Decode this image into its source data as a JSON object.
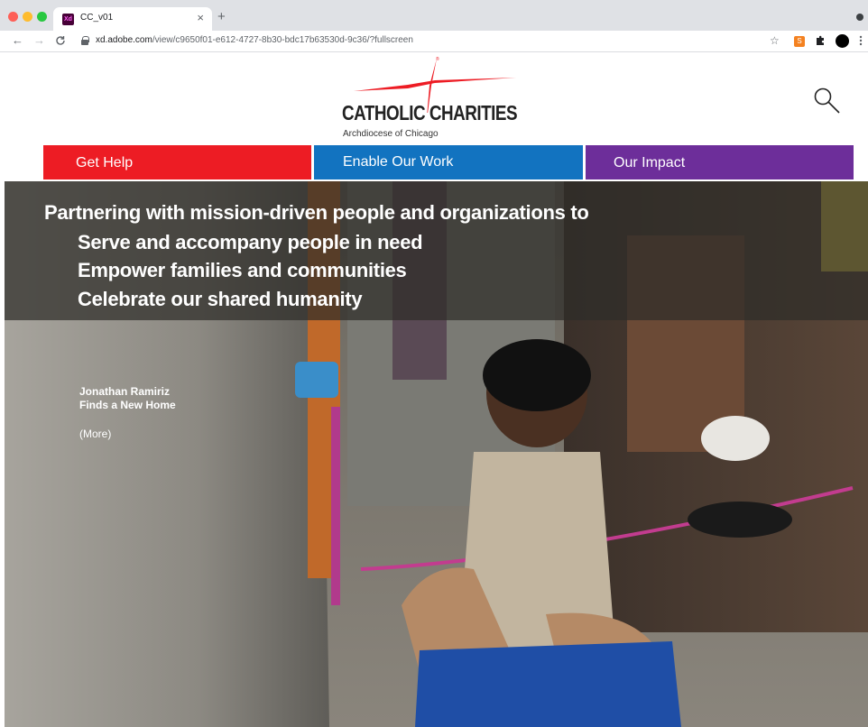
{
  "browser": {
    "tab_title": "CC_v01",
    "tab_favicon": "Xd",
    "tab_close": "×",
    "new_tab": "+",
    "url_host": "xd.adobe.com",
    "url_path": "/view/c9650f01-e612-4727-8b30-bdc17b63530d-9c36/?fullscreen",
    "extension_label": "S",
    "icons": [
      "back-arrow-icon",
      "forward-arrow-icon",
      "reload-icon",
      "lock-icon",
      "star-icon",
      "extension-icon",
      "puzzle-icon",
      "profile-icon",
      "menu-dots-icon"
    ]
  },
  "header": {
    "logo_text": "CATHOLIC CHARITIES",
    "logo_subtitle": "Archdiocese of Chicago",
    "logo_trademark": "®"
  },
  "nav": {
    "items": [
      {
        "label": "Get Help",
        "color": "#ed1c24"
      },
      {
        "label": "Enable Our Work",
        "color": "#1273c0"
      },
      {
        "label": "Our Impact",
        "color": "#6d2e9a"
      }
    ]
  },
  "hero": {
    "headline": "Partnering with mission-driven people and organizations to",
    "bullets": [
      "Serve and accompany people in need",
      "Empower families and communities",
      "Celebrate our shared humanity"
    ],
    "story_title_line1": "Jonathan Ramiriz",
    "story_title_line2": "Finds a New Home",
    "story_more": "(More)"
  },
  "colors": {
    "brand_red": "#ed1c24",
    "brand_blue": "#1273c0",
    "brand_purple": "#6d2e9a"
  }
}
